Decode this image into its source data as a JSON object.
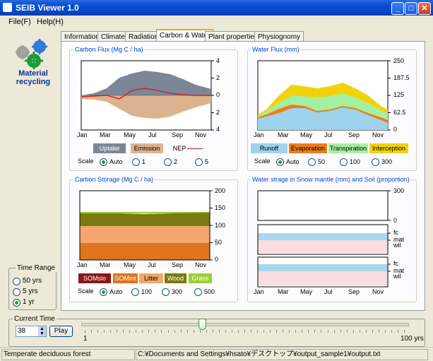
{
  "window": {
    "title": "SEIB Viewer 1.0",
    "min": "_",
    "max": "□",
    "close": "✕"
  },
  "menu": [
    "File(F)",
    "Help(H)"
  ],
  "logo": {
    "line1": "Material",
    "line2": "recycling"
  },
  "tabs": [
    "Information",
    "Climate",
    "Radiation",
    "Carbon & Water",
    "Plant properties",
    "Physiognomy"
  ],
  "months": [
    "Jan",
    "Mar",
    "May",
    "Jul",
    "Sep",
    "Nov"
  ],
  "scale_label": "Scale",
  "carbon_flux": {
    "title": "Carbon Flux (Mg C / ha)",
    "yticks": [
      "4",
      "2",
      "0",
      "2",
      "4"
    ],
    "legend": [
      "Uptake",
      "Emission",
      "NEP"
    ],
    "scale_options": [
      "Auto",
      "1",
      "2",
      "5"
    ],
    "selected": "Auto",
    "colors": {
      "uptake": "#7a8799",
      "emission": "#dcb38f",
      "nep": "#c82020"
    }
  },
  "water_flux": {
    "title": "Water Flux (mm)",
    "yticks": [
      "250",
      "187.5",
      "125",
      "62.5",
      "0"
    ],
    "legend": [
      "Runoff",
      "Evaporation",
      "Transpiration",
      "Interception"
    ],
    "scale_options": [
      "Auto",
      "50",
      "100",
      "300"
    ],
    "selected": "Auto",
    "colors": {
      "runoff": "#9dd3ec",
      "evaporation": "#ee7d1a",
      "transpiration": "#a5f0a0",
      "interception": "#f2d20a"
    }
  },
  "carbon_storage": {
    "title": "Carbon Storage (Mg C / ha)",
    "yticks": [
      "200",
      "150",
      "100",
      "50",
      "0"
    ],
    "legend": [
      "SOMslo",
      "SOMint",
      "Litter",
      "Wood",
      "Grass"
    ],
    "scale_options": [
      "Auto",
      "100",
      "300",
      "500"
    ],
    "selected": "Auto",
    "colors": {
      "somslo": "#8a1818",
      "somint": "#e0731c",
      "litter": "#f5a66a",
      "wood": "#7b7a12",
      "grass": "#9ccf2f"
    }
  },
  "water_storage": {
    "title": "Water strage in Snow mantle (mm) and Soil (proportion)",
    "snow_ticks": [
      "300",
      "0"
    ],
    "soil_ticks": [
      "fc",
      "mat",
      "wil"
    ]
  },
  "time_range": {
    "title": "Time Range",
    "options": [
      "50 yrs",
      "5 yrs",
      "1 yr"
    ],
    "selected": "1 yr"
  },
  "current_time": {
    "title": "Current Time",
    "value": "38",
    "play": "Play",
    "min_label": "1",
    "max_label": "100 yrs",
    "progress": 0.37
  },
  "status": {
    "left": "Temperate deciduous forest",
    "path": "C:¥Documents and Settings¥hsato¥デスクトップ¥output_sample1¥output.txt"
  }
}
